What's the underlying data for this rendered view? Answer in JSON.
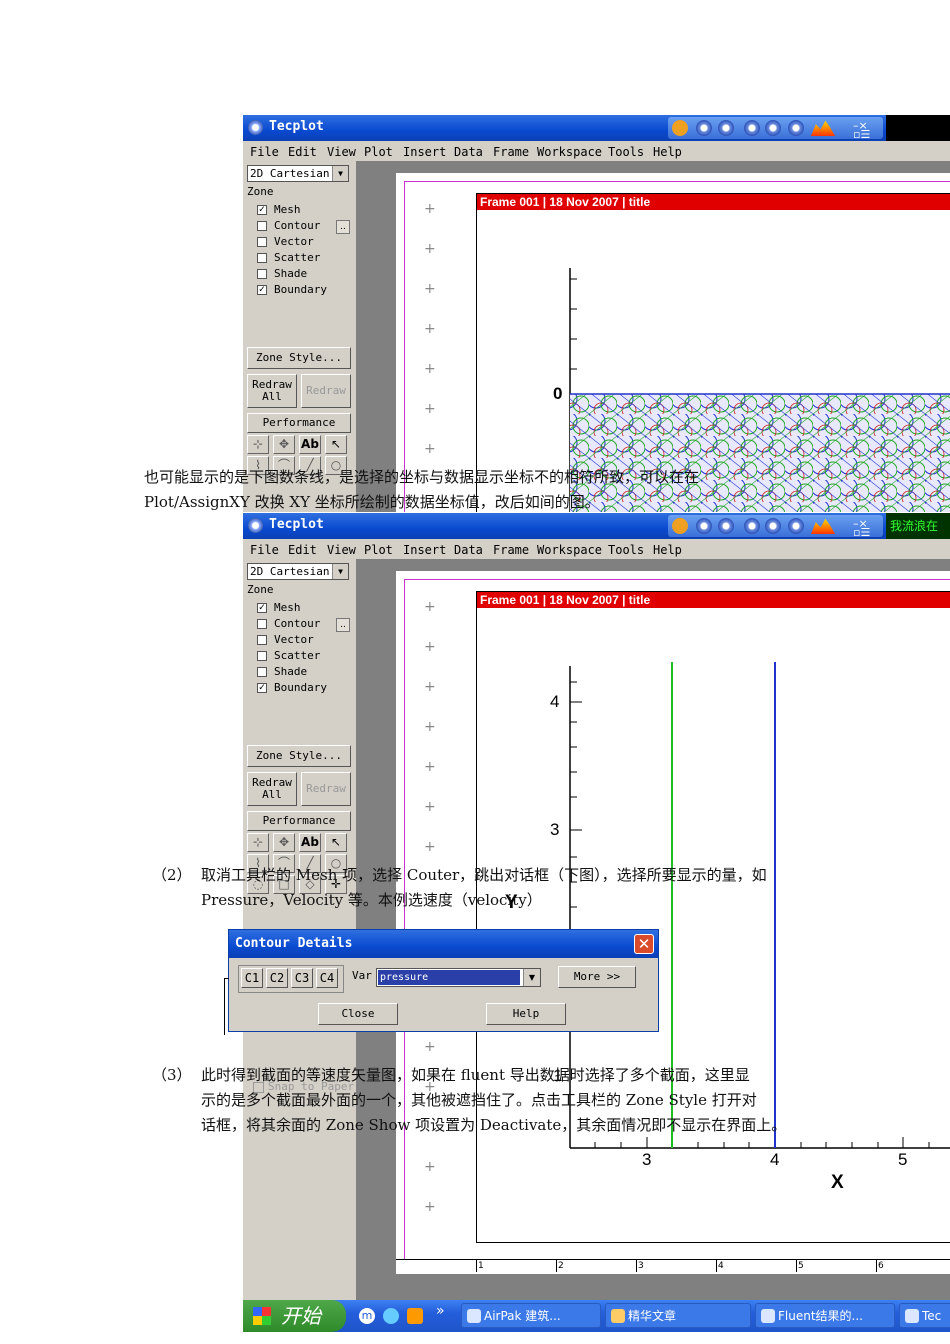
{
  "app": {
    "title": "Tecplot",
    "tray_text_2": "我流浪在",
    "menu": [
      "File",
      "Edit",
      "View",
      "Plot",
      "Insert",
      "Data",
      "Frame",
      "Workspace",
      "Tools",
      "Help"
    ],
    "plot_type": "2D Cartesian",
    "zone_label": "Zone",
    "zone_layers": [
      {
        "label": "Mesh",
        "checked": true
      },
      {
        "label": "Contour",
        "checked": false
      },
      {
        "label": "Vector",
        "checked": false
      },
      {
        "label": "Scatter",
        "checked": false
      },
      {
        "label": "Shade",
        "checked": false
      },
      {
        "label": "Boundary",
        "checked": true
      }
    ],
    "zone_style_button": "Zone Style...",
    "redraw_all_button": "Redraw\nAll",
    "redraw_button": "Redraw",
    "performance_button": "Performance",
    "text_tool": "Ab",
    "snap_to_paper": "Snap to Paper",
    "frame_header": "Frame 001  |  18 Nov 2007  |  title",
    "ruler_labels": [
      "1",
      "2",
      "3",
      "4",
      "5",
      "6"
    ]
  },
  "plot1": {
    "y_tick_label": "0"
  },
  "plot2": {
    "y_tick_labels": [
      "4",
      "3"
    ],
    "y_label": "Y",
    "x_tick_labels": [
      "3",
      "4",
      "5"
    ],
    "x_label": "X",
    "hidden_tick": "1",
    "line_colors": [
      "#22bb22",
      "#2233cc"
    ]
  },
  "text": {
    "para1_line1": "也可能显示的是下图数条线，是选择的坐标与数据显示坐标不的相符所致，可以在在",
    "para1_line2": "Plot/AssignXY 改换 XY 坐标所绘制的数据坐标值，改后如间的图。",
    "step2_num": "（2）",
    "step2_line1": "取消工具栏的 Mesh 项，选择 Couter，跳出对话框（下图），选择所要显示的量，如",
    "step2_line2": "Pressure，Velocity 等。本例选速度（velocity）",
    "step3_num": "（3）",
    "step3_line1": "此时得到截面的等速度矢量图，如果在 fluent 导出数据时选择了多个截面，这里显",
    "step3_line2": "示的是多个截面最外面的一个，其他被遮挡住了。点击工具栏的 Zone Style 打开对",
    "step3_line3": "话框，将其余面的 Zone Show 项设置为 Deactivate，其余面情况即不显示在界面上。"
  },
  "dialog": {
    "title": "Contour Details",
    "tabs": [
      "C1",
      "C2",
      "C3",
      "C4"
    ],
    "var_label": "Var",
    "var_value": "pressure",
    "more_button": "More >>",
    "close_button": "Close",
    "help_button": "Help"
  },
  "taskbar": {
    "start_label": "开始",
    "chevron": "»",
    "tasks": [
      "AirPak 建筑...",
      "精华文章",
      "Fluent结果的...",
      "Tec"
    ]
  }
}
